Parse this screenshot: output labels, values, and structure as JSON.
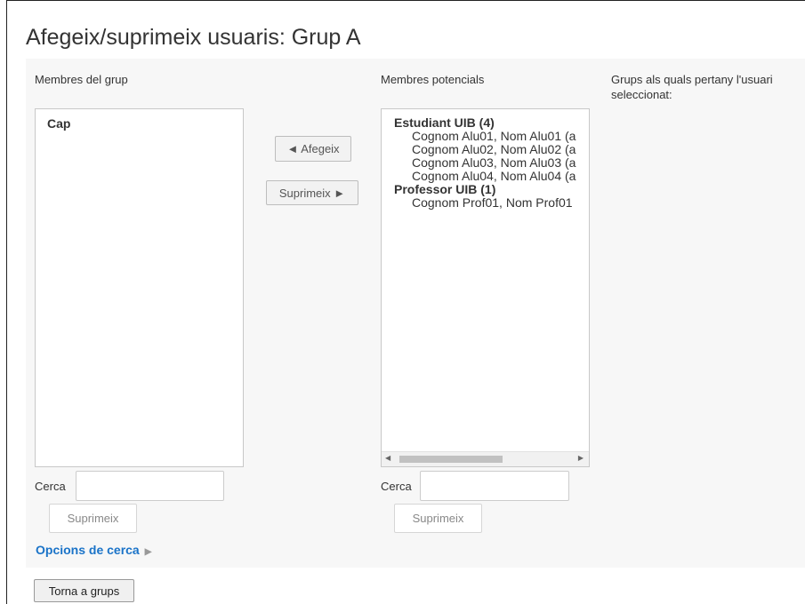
{
  "page": {
    "title": "Afegeix/suprimeix usuaris: Grup A"
  },
  "members": {
    "label": "Membres del grup",
    "items": [
      "Cap"
    ],
    "search_label": "Cerca",
    "search_value": "",
    "clear_button": "Suprimeix"
  },
  "actions": {
    "add_button": "◄ Afegeix",
    "remove_button": "Suprimeix ►"
  },
  "potential": {
    "label": "Membres potencials",
    "groups": [
      {
        "label": "Estudiant UIB (4)",
        "options": [
          "Cognom Alu01, Nom Alu01 (a",
          "Cognom Alu02, Nom Alu02 (a",
          "Cognom Alu03, Nom Alu03 (a",
          "Cognom Alu04, Nom Alu04 (a"
        ]
      },
      {
        "label": "Professor UIB (1)",
        "options": [
          "Cognom Prof01, Nom Prof01"
        ]
      }
    ],
    "search_label": "Cerca",
    "search_value": "",
    "clear_button": "Suprimeix"
  },
  "user_groups": {
    "label": "Grups als quals pertany l'usuari seleccionat:"
  },
  "search_options": {
    "label": "Opcions de cerca"
  },
  "footer": {
    "back_button": "Torna a grups"
  },
  "icons": {
    "search_options_expand": "triangle-right-icon",
    "scroll_left": "triangle-left-icon",
    "scroll_right": "triangle-right-icon"
  }
}
